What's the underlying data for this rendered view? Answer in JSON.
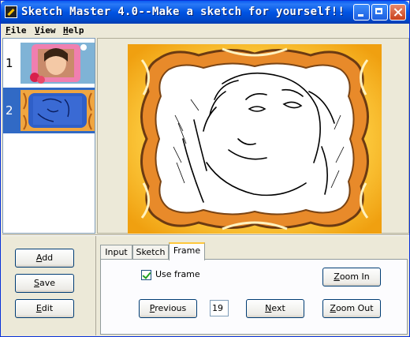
{
  "window": {
    "title": "Sketch Master 4.0--Make a sketch for yourself!!",
    "icon": "app-brush-icon",
    "controls": [
      "minimize-icon",
      "maximize-icon",
      "close-icon"
    ]
  },
  "menu": {
    "items": [
      {
        "label": "File"
      },
      {
        "label": "View"
      },
      {
        "label": "Help"
      }
    ]
  },
  "thumbnails": [
    {
      "number": "1",
      "selected": false,
      "description": "photo-with-pink-frame"
    },
    {
      "number": "2",
      "selected": true,
      "description": "sketch-with-orange-frame"
    }
  ],
  "preview": {
    "icon": "sketch-preview-image",
    "frame_color": "#f29a1c"
  },
  "actions": {
    "add": "Add",
    "save": "Save",
    "edit": "Edit"
  },
  "tabs": [
    {
      "label": "Input",
      "active": false
    },
    {
      "label": "Sketch",
      "active": false
    },
    {
      "label": "Frame",
      "active": true
    }
  ],
  "frame_panel": {
    "use_frame_label": "Use frame",
    "use_frame_checked": true,
    "previous_label": "Previous",
    "frame_number": "19",
    "next_label": "Next",
    "zoom_in_label": "Zoom In",
    "zoom_out_label": "Zoom Out"
  },
  "colors": {
    "title_bar": "#0054e3",
    "selection": "#316ac5",
    "active_tab_accent": "#ffc83c",
    "window_bg": "#ece9d8"
  }
}
